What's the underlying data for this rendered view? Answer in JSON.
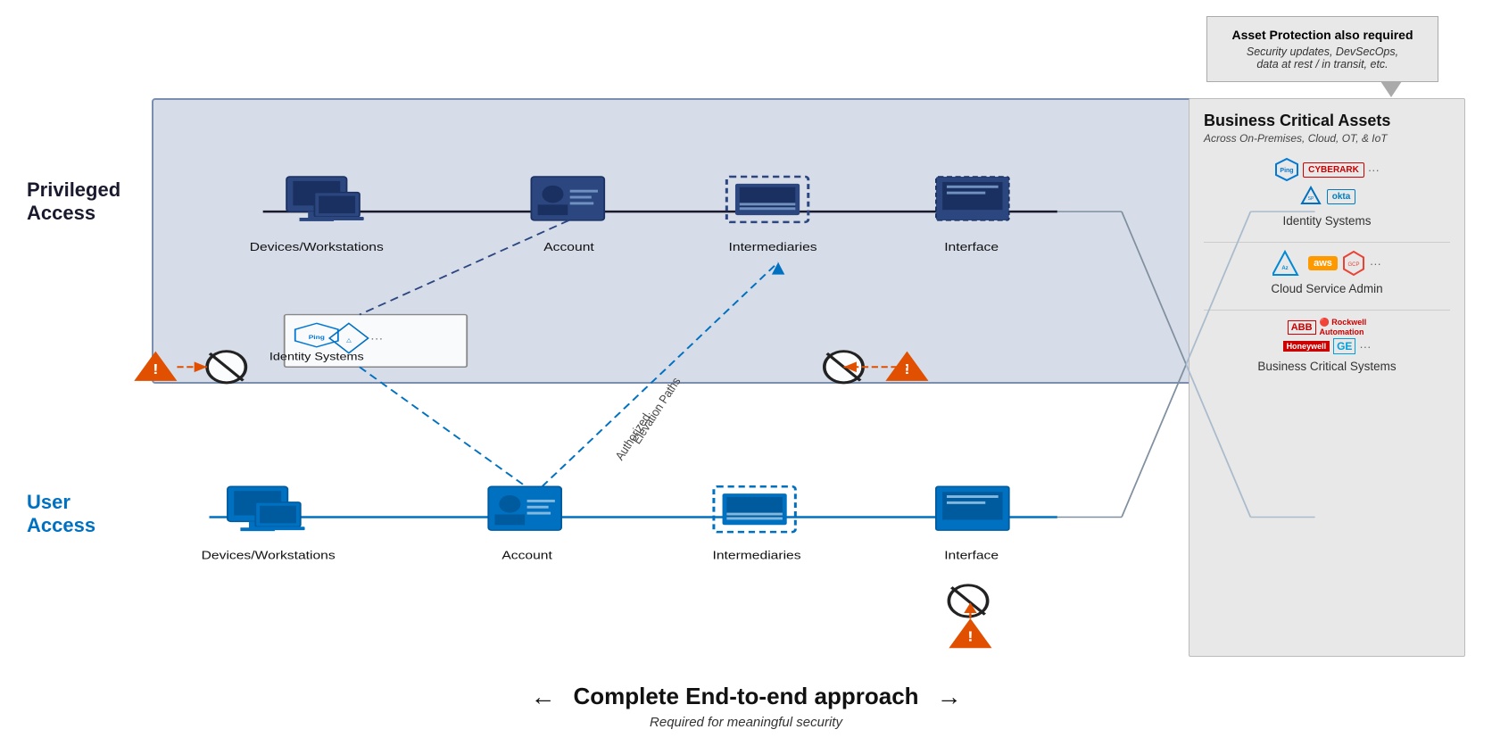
{
  "asset_protection": {
    "title": "Asset Protection also required",
    "subtitle": "Security updates, DevSecOps,\ndata at rest / in transit, etc."
  },
  "privileged_access": {
    "label": "Privileged Access"
  },
  "user_access": {
    "label": "User Access"
  },
  "privileged_row": {
    "devices_label": "Devices/Workstations",
    "account_label": "Account",
    "intermediaries_label": "Intermediaries",
    "interface_label": "Interface"
  },
  "user_row": {
    "devices_label": "Devices/Workstations",
    "account_label": "Account",
    "intermediaries_label": "Intermediaries",
    "interface_label": "Interface"
  },
  "identity_systems": {
    "label": "Identity Systems"
  },
  "elevation": {
    "label": "Authorized\nElevation Paths"
  },
  "bca": {
    "title": "Business Critical Assets",
    "subtitle": "Across On-Premises, Cloud, OT, & IoT",
    "sections": [
      {
        "label": "Identity Systems",
        "logos": [
          "Ping",
          "CyberArk",
          "SailPoint",
          "okta",
          "..."
        ]
      },
      {
        "label": "Cloud Service Admin",
        "logos": [
          "Azure",
          "aws",
          "GCP",
          "..."
        ]
      },
      {
        "label": "Business Critical Systems",
        "logos": [
          "ABB",
          "Rockwell Automation",
          "Honeywell",
          "GE",
          "..."
        ]
      }
    ]
  },
  "bottom": {
    "title": "Complete End-to-end approach",
    "subtitle": "Required for meaningful security"
  }
}
